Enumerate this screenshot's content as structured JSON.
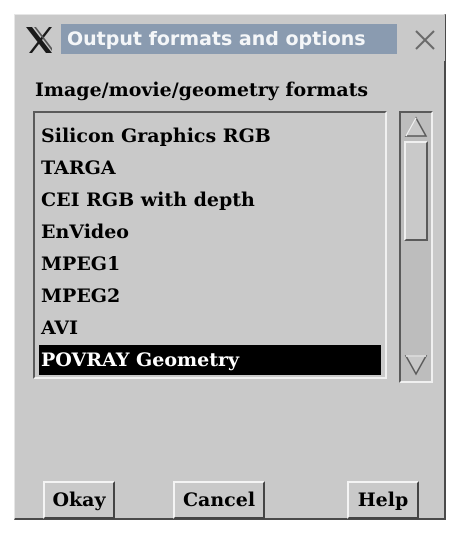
{
  "window": {
    "title": "Output formats and options"
  },
  "section": {
    "label": "Image/movie/geometry formats"
  },
  "formats": {
    "items": [
      "Silicon Graphics RGB",
      "TARGA",
      "CEI RGB with depth",
      "EnVideo",
      "MPEG1",
      "MPEG2",
      "AVI",
      "POVRAY Geometry"
    ],
    "selected": "POVRAY Geometry"
  },
  "buttons": {
    "okay": "Okay",
    "cancel": "Cancel",
    "help": "Help"
  },
  "icons": {
    "logo": "x-window-system-icon",
    "close": "close-icon",
    "scroll_up": "scroll-up-arrow-icon",
    "scroll_down": "scroll-down-arrow-icon"
  },
  "colors": {
    "dialog_background": "#c9c9c9",
    "title_highlight": "#8a9bb0",
    "selection_background": "#000000",
    "selection_text": "#ffffff"
  }
}
